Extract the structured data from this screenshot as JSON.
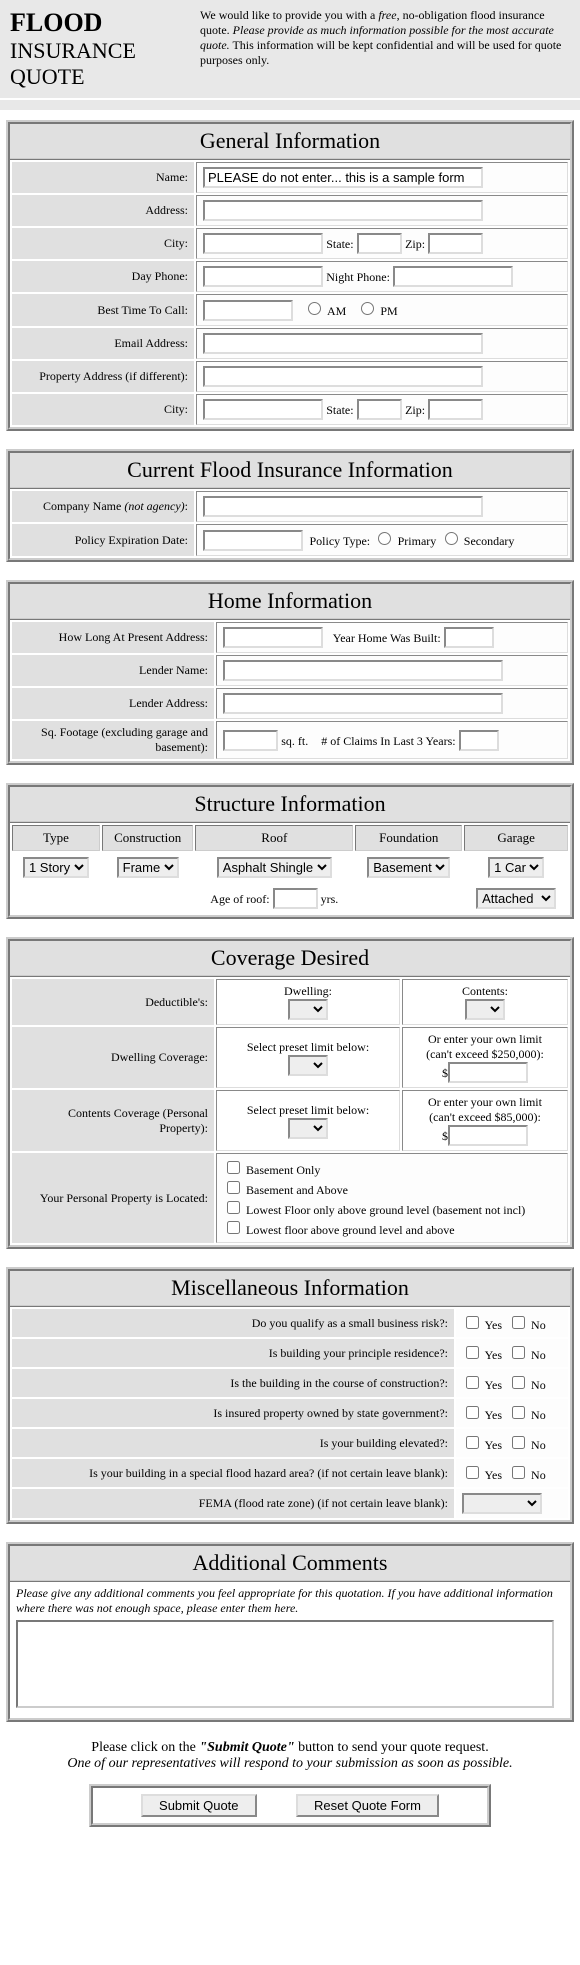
{
  "header": {
    "title1": "FLOOD",
    "title2": "INSURANCE QUOTE",
    "intro_pre": "We would like to provide you with a ",
    "intro_free": "free",
    "intro_mid": ", no-obligation flood insurance quote. ",
    "intro_em": "Please provide as much information possible for the most accurate quote.",
    "intro_post": " This information will be kept confidential and will be used for quote purposes only."
  },
  "general": {
    "title": "General Information",
    "name_label": "Name:",
    "name_value": "PLEASE do not enter... this is a sample form",
    "address_label": "Address:",
    "city_label": "City:",
    "state_label": "State:",
    "zip_label": "Zip:",
    "dayphone_label": "Day Phone:",
    "nightphone_label": "Night Phone:",
    "besttime_label": "Best Time To Call:",
    "am": "AM",
    "pm": "PM",
    "email_label": "Email Address:",
    "propaddr_label": "Property Address (if different):"
  },
  "current": {
    "title": "Current Flood Insurance Information",
    "company_label_pre": "Company Name ",
    "company_label_em": "(not agency)",
    "company_label_post": ":",
    "expire_label": "Policy Expiration Date:",
    "policytype_label": "Policy Type:",
    "primary": "Primary",
    "secondary": "Secondary"
  },
  "home": {
    "title": "Home Information",
    "howlong_label": "How Long At Present Address:",
    "yearbuilt_label": "Year Home Was Built:",
    "lendername_label": "Lender Name:",
    "lenderaddr_label": "Lender Address:",
    "sqft_label": "Sq. Footage (excluding garage and basement):",
    "sqft_unit": "sq. ft.",
    "claims_label": "# of Claims In Last 3 Years:"
  },
  "structure": {
    "title": "Structure Information",
    "type_h": "Type",
    "construction_h": "Construction",
    "roof_h": "Roof",
    "foundation_h": "Foundation",
    "garage_h": "Garage",
    "type_v": "1 Story",
    "construction_v": "Frame",
    "roof_v": "Asphalt Shingle",
    "foundation_v": "Basement",
    "garage_v": "1 Car",
    "ageroof_label": "Age of roof:",
    "yrs": "yrs.",
    "garage2_v": "Attached"
  },
  "coverage": {
    "title": "Coverage Desired",
    "deductible_label": "Deductible's:",
    "dwelling": "Dwelling:",
    "contents": "Contents:",
    "dwellcov_label": "Dwelling Coverage:",
    "preset": "Select preset limit below:",
    "ownlimit_dwell_1": "Or enter your own limit",
    "ownlimit_dwell_2": "(can't exceed $250,000):",
    "contcov_label": "Contents Coverage (Personal Property):",
    "ownlimit_cont_2": "(can't exceed $85,000):",
    "dollar": "$",
    "pp_label": "Your Personal Property is Located:",
    "pp1": "Basement Only",
    "pp2": "Basement and Above",
    "pp3": "Lowest Floor only above ground level (basement not incl)",
    "pp4": "Lowest floor above ground level and above"
  },
  "misc": {
    "title": "Miscellaneous Information",
    "q1": "Do you qualify as a small business risk?:",
    "q2": "Is building your principle residence?:",
    "q3": "Is the building in the course of construction?:",
    "q4": "Is insured property owned by state government?:",
    "q5": "Is your building elevated?:",
    "q6": "Is your building in a special flood hazard area? (if not certain leave blank):",
    "q7": "FEMA (flood rate zone) (if not certain leave blank):",
    "yes": "Yes",
    "no": "No"
  },
  "comments": {
    "title": "Additional Comments",
    "instr": "Please give any additional comments you feel appropriate for this quotation. If you have additional information where there was not enough space, please enter them here."
  },
  "submit": {
    "line1_pre": "Please click on the ",
    "line1_strong": "\"Submit Quote\"",
    "line1_post": " button to send your quote request.",
    "line2": "One of our representatives will respond to your submission as soon as possible.",
    "submit_btn": "Submit Quote",
    "reset_btn": "Reset Quote Form"
  }
}
